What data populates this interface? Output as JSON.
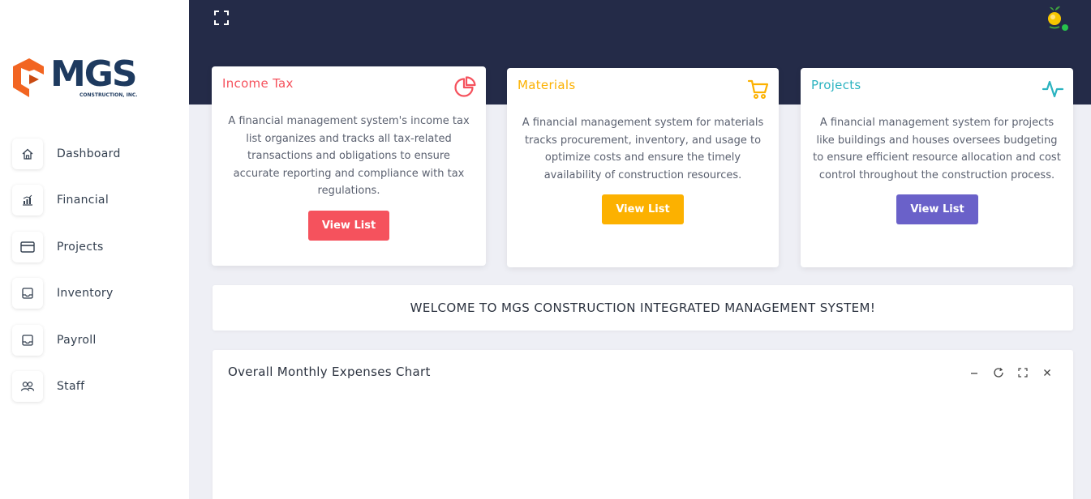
{
  "brand": {
    "name": "MGS",
    "subtitle": "CONSTRUCTION, INC.",
    "accent_orange": "#f26522",
    "navy": "#1e3a5f"
  },
  "sidebar": {
    "items": [
      {
        "label": "Dashboard",
        "icon": "home-icon"
      },
      {
        "label": "Financial",
        "icon": "chart-bars-icon"
      },
      {
        "label": "Projects",
        "icon": "credit-card-icon"
      },
      {
        "label": "Inventory",
        "icon": "inbox-icon"
      },
      {
        "label": "Payroll",
        "icon": "inbox-icon"
      },
      {
        "label": "Staff",
        "icon": "users-icon"
      }
    ]
  },
  "topbar": {
    "background": "#242b48",
    "fullscreen_icon": "fullscreen-icon",
    "avatar_icon": "user-avatar-icon"
  },
  "cards": [
    {
      "title": "Income Tax",
      "icon": "pie-chart-icon",
      "color": "#f5525d",
      "description": "A financial management system's income tax list organizes and tracks all tax-related transactions and obligations to ensure accurate reporting and compliance with tax regulations.",
      "button": "View List"
    },
    {
      "title": "Materials",
      "icon": "shopping-cart-icon",
      "color": "#fcb100",
      "description": "A financial management system for materials tracks procurement, inventory, and usage to optimize costs and ensure the timely availability of construction resources.",
      "button": "View List"
    },
    {
      "title": "Projects",
      "icon": "activity-icon",
      "color": "#2bb3c0",
      "button_color": "#6a61c9",
      "description": "A financial management system for projects like buildings and houses oversees budgeting to ensure efficient resource allocation and cost control throughout the construction process.",
      "button": "View List"
    }
  ],
  "welcome": {
    "text": "WELCOME TO MGS CONSTRUCTION INTEGRATED MANAGEMENT SYSTEM!"
  },
  "chart_panel": {
    "title": "Overall Monthly Expenses Chart",
    "tools": [
      "minimize-icon",
      "refresh-icon",
      "expand-icon",
      "close-icon"
    ]
  }
}
